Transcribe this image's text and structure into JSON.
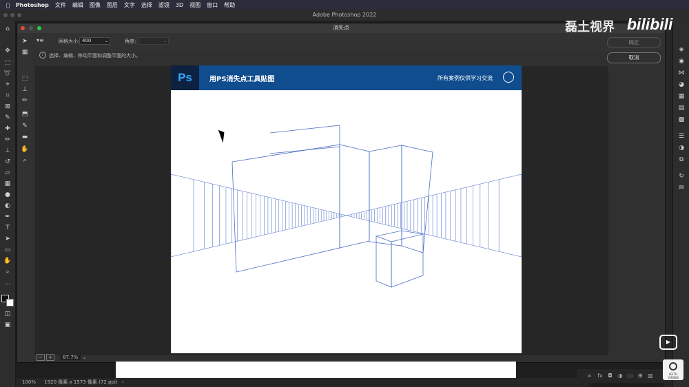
{
  "menubar": {
    "apple": "",
    "app": "Photoshop",
    "items": [
      "文件",
      "编辑",
      "图像",
      "图层",
      "文字",
      "选择",
      "滤镜",
      "3D",
      "视图",
      "窗口",
      "帮助"
    ]
  },
  "window": {
    "title": "Adobe Photoshop 2022"
  },
  "dialog": {
    "title": "消失点",
    "grid_size_label": "网格大小:",
    "grid_size_value": "400",
    "angle_label": "角度:",
    "angle_value": "",
    "hint": "选择、编辑、移动平面和调整平面的大小。",
    "ok_label": "确定",
    "cancel_label": "取消",
    "zoom_value": "87.7%"
  },
  "document": {
    "logo": "Ps",
    "title": "用PS消失点工具贴图",
    "note": "所有案例仅供学习交流"
  },
  "status": {
    "zoom": "100%",
    "info": "1920 像素 x 1573 像素 (72 ppi)"
  },
  "overlay": {
    "watermark": "磊土视界",
    "site": "bilibili",
    "badge": "LEITU VISION"
  },
  "colors": {
    "accent_blue": "#0f4d8f",
    "grid_line": "#3c63c4"
  }
}
